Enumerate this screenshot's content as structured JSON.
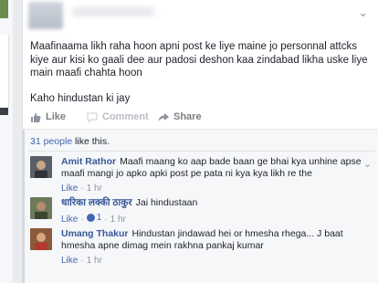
{
  "post": {
    "text_line1": "Maafinaama likh raha hoon apni post ke liye maine jo personnal attcks kiye aur kisi ko gaali dee aur padosi deshon kaa zindabad likha uske liye main maafi chahta hoon",
    "text_line2": "Kaho hindustan ki jay"
  },
  "actions": {
    "like": "Like",
    "comment": "Comment",
    "share": "Share"
  },
  "likes": {
    "count_link": "31 people",
    "suffix": " like this."
  },
  "comments": [
    {
      "author": "Amit Rathor",
      "text": "Maafi maang ko aap bade baan ge bhai kya unhine apse maafi mangi jo apko apki post pe pata ni kya kya likh re the",
      "like_label": "Like",
      "time": "1 hr",
      "like_count": ""
    },
    {
      "author": "धारिका लक्की ठाकुर",
      "text": "Jai hindustaan",
      "like_label": "Like",
      "time": "1 hr",
      "like_count": "1"
    },
    {
      "author": "Umang Thakur",
      "text": "Hindustan jindawad hei or hmesha rhega... J baat hmesha apne dimag mein rakhna pankaj kumar",
      "like_label": "Like",
      "time": "1 hr",
      "like_count": ""
    }
  ],
  "colors": {
    "link": "#4267b2",
    "author": "#365899",
    "meta": "#90949c"
  },
  "icons": {
    "chevron": "chevron-down-icon",
    "like": "thumbs-up-icon",
    "comment": "comment-bubble-icon",
    "share": "share-arrow-icon"
  }
}
